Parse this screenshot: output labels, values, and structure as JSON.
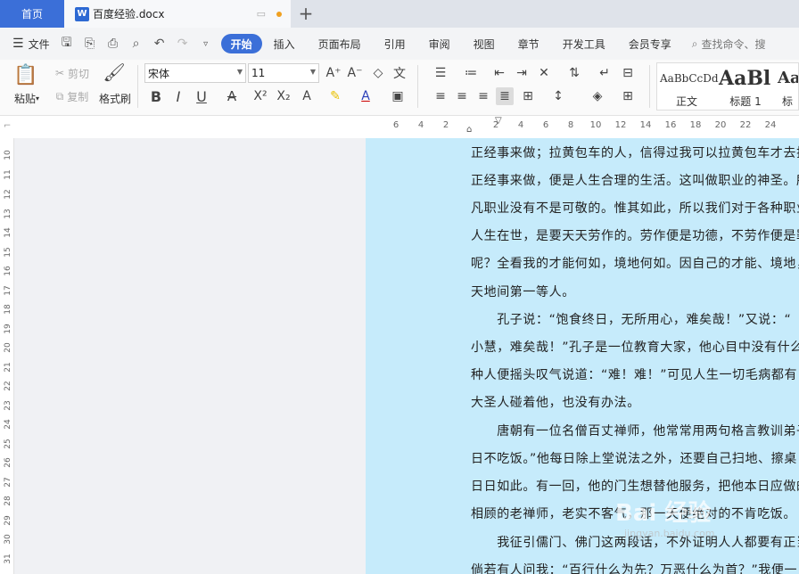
{
  "tabs": {
    "home": "首页",
    "document": "百度经验.docx"
  },
  "menu": {
    "file": "文件",
    "ribbon_tabs": [
      "开始",
      "插入",
      "页面布局",
      "引用",
      "审阅",
      "视图",
      "章节",
      "开发工具",
      "会员专享"
    ],
    "search": "查找命令、搜"
  },
  "ribbon": {
    "paste": "粘贴",
    "cut": "剪切",
    "copy": "复制",
    "format_painter": "格式刷",
    "font_name": "宋体",
    "font_size": "11",
    "styles": [
      {
        "preview": "AaBbCcDd",
        "label": "正文"
      },
      {
        "preview": "AaBl",
        "label": "标题 1"
      },
      {
        "preview": "AaB",
        "label": "标"
      }
    ]
  },
  "ruler": {
    "h_ticks": [
      "6",
      "4",
      "2",
      "",
      "2",
      "4",
      "6",
      "8",
      "10",
      "12",
      "14",
      "16",
      "18",
      "20",
      "22",
      "24"
    ],
    "v_ticks": [
      "10",
      "11",
      "12",
      "13",
      "14",
      "15",
      "16",
      "17",
      "18",
      "19",
      "20",
      "21",
      "22",
      "23",
      "24",
      "25",
      "26",
      "27",
      "28",
      "29",
      "30",
      "31"
    ]
  },
  "document": {
    "lines": [
      "正经事来做；拉黄包车的人，信得过我可以拉黄包车才去拉",
      "正经事来做，便是人生合理的生活。这叫做职业的神圣。所",
      "凡职业没有不是可敬的。惟其如此，所以我们对于各种职业",
      "人生在世，是要天天劳作的。劳作便是功德，不劳作便是罪",
      "呢？全看我的才能何如，境地何如。因自己的才能、境地，",
      "天地间第一等人。",
      "　　孔子说：“饱食终日，无所用心，难矣哉！”又说：“",
      "小慧，难矣哉！”孔子是一位教育大家，他心目中没有什么",
      "种人便摇头叹气说道：“难！难！”可见人生一切毛病都有",
      "大圣人碰着他，也没有办法。",
      "　　唐朝有一位名僧百丈禅师，他常常用两句格言教训弟子",
      "日不吃饭。”他每日除上堂说法之外，还要自己扫地、擦桌",
      "日日如此。有一回，他的门生想替他服务，把他本日应做的",
      "相顾的老禅师，老实不客气，那一天便绝对的不肯吃饭。",
      "　　我征引儒门、佛门这两段话，不外证明人人都要有正当",
      "倘若有人问我：“百行什么为先？万恶什么为首？”我便一"
    ]
  },
  "watermark": {
    "text": "Bai 经验",
    "sub": "jingyan.baidu.com"
  }
}
